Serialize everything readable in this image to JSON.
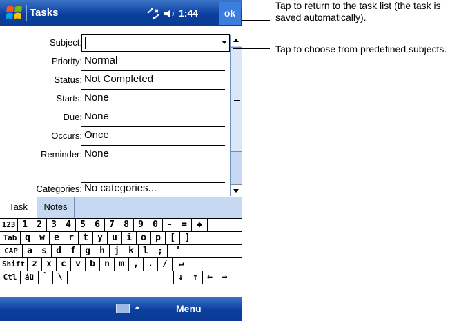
{
  "titlebar": {
    "title": "Tasks",
    "clock": "1:44",
    "ok_label": "ok"
  },
  "form": {
    "subject": {
      "label": "Subject:",
      "value": ""
    },
    "priority": {
      "label": "Priority:",
      "value": "Normal"
    },
    "status": {
      "label": "Status:",
      "value": "Not Completed"
    },
    "starts": {
      "label": "Starts:",
      "value": "None"
    },
    "due": {
      "label": "Due:",
      "value": "None"
    },
    "occurs": {
      "label": "Occurs:",
      "value": "Once"
    },
    "reminder": {
      "label": "Reminder:",
      "value": "None"
    },
    "categories": {
      "label": "Categories:",
      "value": "No categories..."
    }
  },
  "tabs": {
    "task": "Task",
    "notes": "Notes"
  },
  "keyboard": {
    "row1": [
      "123",
      "1",
      "2",
      "3",
      "4",
      "5",
      "6",
      "7",
      "8",
      "9",
      "0",
      "-",
      "=",
      "◆"
    ],
    "row2": [
      "Tab",
      "q",
      "w",
      "e",
      "r",
      "t",
      "y",
      "u",
      "i",
      "o",
      "p",
      "[",
      "]"
    ],
    "row3": [
      "CAP",
      "a",
      "s",
      "d",
      "f",
      "g",
      "h",
      "j",
      "k",
      "l",
      ";",
      "'"
    ],
    "row4": [
      "Shift",
      "z",
      "x",
      "c",
      "v",
      "b",
      "n",
      "m",
      ",",
      ".",
      "/",
      "↵"
    ],
    "row5": [
      "Ctl",
      "áü",
      "`",
      "\\",
      "↓",
      "↑",
      "←",
      "→"
    ]
  },
  "menubar": {
    "menu_label": "Menu"
  },
  "callouts": {
    "ok": "Tap to return to the task list (the task is saved automatically).",
    "subject": "Tap to choose from predefined subjects."
  },
  "colors": {
    "titlebar": "#0a3f9e",
    "accent": "#3a7fe0",
    "panel": "#c7d8f3"
  },
  "icons": [
    "windows-start-icon",
    "connectivity-icon",
    "volume-icon",
    "keyboard-icon"
  ]
}
